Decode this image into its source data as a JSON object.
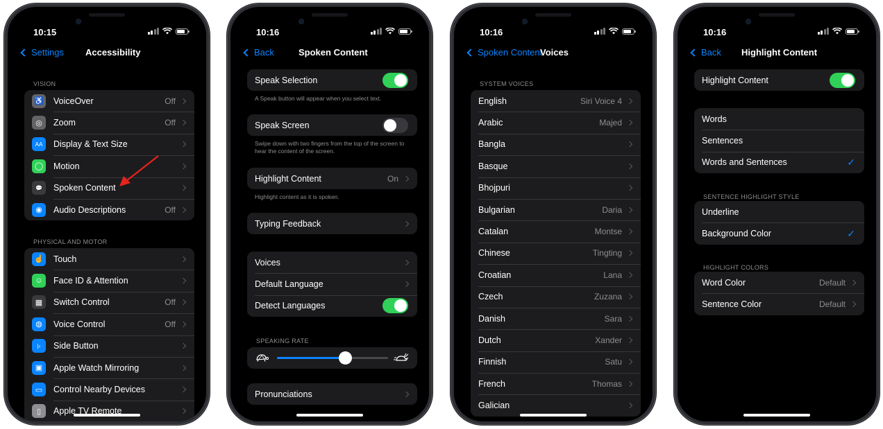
{
  "phones": [
    {
      "time": "10:15",
      "back": "Settings",
      "title": "Accessibility",
      "sections": [
        {
          "header": "VISION",
          "rows": [
            {
              "label": "VoiceOver",
              "value": "Off",
              "icon": "voiceover-icon",
              "color": "#636366"
            },
            {
              "label": "Zoom",
              "value": "Off",
              "icon": "zoom-icon",
              "color": "#636366"
            },
            {
              "label": "Display & Text Size",
              "value": "",
              "icon": "text-size-icon",
              "color": "#0a84ff"
            },
            {
              "label": "Motion",
              "value": "",
              "icon": "motion-icon",
              "color": "#30d158"
            },
            {
              "label": "Spoken Content",
              "value": "",
              "icon": "speech-bubble-icon",
              "color": "#3a3a3c"
            },
            {
              "label": "Audio Descriptions",
              "value": "Off",
              "icon": "audio-description-icon",
              "color": "#0a84ff"
            }
          ]
        },
        {
          "header": "PHYSICAL AND MOTOR",
          "rows": [
            {
              "label": "Touch",
              "value": "",
              "icon": "hand-icon",
              "color": "#0a84ff"
            },
            {
              "label": "Face ID & Attention",
              "value": "",
              "icon": "face-id-icon",
              "color": "#30d158"
            },
            {
              "label": "Switch Control",
              "value": "Off",
              "icon": "grid-icon",
              "color": "#3a3a3c"
            },
            {
              "label": "Voice Control",
              "value": "Off",
              "icon": "voice-control-icon",
              "color": "#0a84ff"
            },
            {
              "label": "Side Button",
              "value": "",
              "icon": "side-button-icon",
              "color": "#0a84ff"
            },
            {
              "label": "Apple Watch Mirroring",
              "value": "",
              "icon": "watch-icon",
              "color": "#0a84ff"
            },
            {
              "label": "Control Nearby Devices",
              "value": "",
              "icon": "devices-icon",
              "color": "#0a84ff"
            },
            {
              "label": "Apple TV Remote",
              "value": "",
              "icon": "remote-icon",
              "color": "#8e8e93"
            }
          ]
        }
      ]
    },
    {
      "time": "10:16",
      "back": "Back",
      "title": "Spoken Content",
      "speak_selection": {
        "label": "Speak Selection",
        "footer": "A Speak button will appear when you select text."
      },
      "speak_screen": {
        "label": "Speak Screen",
        "footer": "Swipe down with two fingers from the top of the screen to hear the content of the screen."
      },
      "highlight": {
        "label": "Highlight Content",
        "value": "On",
        "footer": "Highlight content as it is spoken."
      },
      "typing": {
        "label": "Typing Feedback"
      },
      "voices": {
        "label": "Voices"
      },
      "default_language": {
        "label": "Default Language"
      },
      "detect_languages": {
        "label": "Detect Languages"
      },
      "speaking_rate": {
        "header": "SPEAKING RATE",
        "level": 0.61
      },
      "pronunciations": {
        "label": "Pronunciations"
      }
    },
    {
      "time": "10:16",
      "back": "Spoken Content",
      "title": "Voices",
      "header": "SYSTEM VOICES",
      "rows": [
        {
          "label": "English",
          "value": "Siri Voice 4"
        },
        {
          "label": "Arabic",
          "value": "Majed"
        },
        {
          "label": "Bangla",
          "value": ""
        },
        {
          "label": "Basque",
          "value": ""
        },
        {
          "label": "Bhojpuri",
          "value": ""
        },
        {
          "label": "Bulgarian",
          "value": "Daria"
        },
        {
          "label": "Catalan",
          "value": "Montse"
        },
        {
          "label": "Chinese",
          "value": "Tingting"
        },
        {
          "label": "Croatian",
          "value": "Lana"
        },
        {
          "label": "Czech",
          "value": "Zuzana"
        },
        {
          "label": "Danish",
          "value": "Sara"
        },
        {
          "label": "Dutch",
          "value": "Xander"
        },
        {
          "label": "Finnish",
          "value": "Satu"
        },
        {
          "label": "French",
          "value": "Thomas"
        },
        {
          "label": "Galician",
          "value": ""
        }
      ]
    },
    {
      "time": "10:16",
      "back": "Back",
      "title": "Highlight Content",
      "toggle_label": "Highlight Content",
      "modes": [
        "Words",
        "Sentences",
        "Words and Sentences"
      ],
      "style_header": "SENTENCE HIGHLIGHT STYLE",
      "styles": [
        "Underline",
        "Background Color"
      ],
      "colors_header": "HIGHLIGHT COLORS",
      "colors": [
        {
          "label": "Word Color",
          "value": "Default"
        },
        {
          "label": "Sentence Color",
          "value": "Default"
        }
      ]
    }
  ]
}
